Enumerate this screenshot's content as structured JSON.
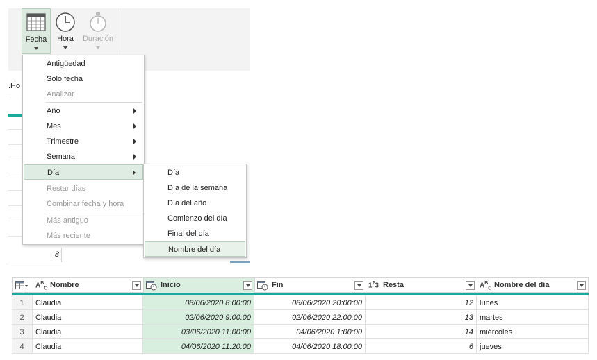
{
  "ribbon": {
    "buttons": [
      {
        "label": "Fecha",
        "icon": "calendar-icon",
        "state": "pressed"
      },
      {
        "label": "Hora",
        "icon": "clock-icon",
        "state": "normal"
      },
      {
        "label": "Duración",
        "icon": "stopwatch-icon",
        "state": "disabled"
      }
    ]
  },
  "background": {
    "formula_fragment": ".Ho",
    "row_value": "8"
  },
  "date_menu": {
    "items": [
      {
        "label": "Antigüedad",
        "enabled": true
      },
      {
        "label": "Solo fecha",
        "enabled": true
      },
      {
        "label": "Analizar",
        "enabled": false
      },
      {
        "label": "Año",
        "enabled": true,
        "submenu": true
      },
      {
        "label": "Mes",
        "enabled": true,
        "submenu": true
      },
      {
        "label": "Trimestre",
        "enabled": true,
        "submenu": true
      },
      {
        "label": "Semana",
        "enabled": true,
        "submenu": true
      },
      {
        "label": "Día",
        "enabled": true,
        "submenu": true,
        "active": true
      },
      {
        "label": "Restar días",
        "enabled": false
      },
      {
        "label": "Combinar fecha y hora",
        "enabled": false
      },
      {
        "label": "Más antiguo",
        "enabled": false
      },
      {
        "label": "Más reciente",
        "enabled": false
      }
    ]
  },
  "day_submenu": {
    "items": [
      {
        "label": "Día"
      },
      {
        "label": "Día de la semana"
      },
      {
        "label": "Día del año"
      },
      {
        "label": "Comienzo del día"
      },
      {
        "label": "Final del día"
      },
      {
        "label": "Nombre del día",
        "hover": true
      }
    ]
  },
  "table": {
    "columns": [
      {
        "type": "ABC",
        "name": "Nombre"
      },
      {
        "type": "datetime",
        "name": "Inicio",
        "selected": true
      },
      {
        "type": "datetime",
        "name": "Fin"
      },
      {
        "type": "123",
        "name": "Resta"
      },
      {
        "type": "ABC",
        "name": "Nombre del día"
      }
    ],
    "rows": [
      {
        "n": "1",
        "nombre": "Claudia",
        "inicio": "08/06/2020 8:00:00",
        "fin": "08/06/2020 20:00:00",
        "resta": "12",
        "dia": "lunes"
      },
      {
        "n": "2",
        "nombre": "Claudia",
        "inicio": "02/06/2020 9:00:00",
        "fin": "02/06/2020 22:00:00",
        "resta": "13",
        "dia": "martes"
      },
      {
        "n": "3",
        "nombre": "Claudia",
        "inicio": "03/06/2020 11:00:00",
        "fin": "04/06/2020 1:00:00",
        "resta": "14",
        "dia": "miércoles"
      },
      {
        "n": "4",
        "nombre": "Claudia",
        "inicio": "04/06/2020 11:20:00",
        "fin": "04/06/2020 18:00:00",
        "resta": "6",
        "dia": "jueves"
      }
    ]
  },
  "colors": {
    "accent_teal": "#1aaa98",
    "selection_green": "#dbefe0"
  }
}
